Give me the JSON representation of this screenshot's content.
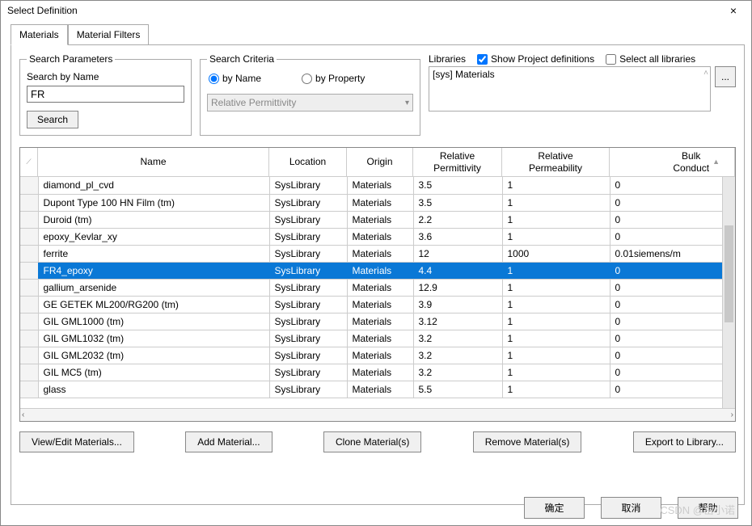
{
  "window": {
    "title": "Select Definition",
    "close": "×"
  },
  "tabs": {
    "materials": "Materials",
    "filters": "Material Filters"
  },
  "search_params": {
    "legend": "Search Parameters",
    "label": "Search by Name",
    "value": "FR",
    "button": "Search"
  },
  "search_criteria": {
    "legend": "Search Criteria",
    "by_name": "by Name",
    "by_property": "by Property",
    "selected": "name",
    "property_dropdown": "Relative Permittivity"
  },
  "libraries": {
    "label": "Libraries",
    "show_project": "Show Project definitions",
    "show_project_checked": true,
    "select_all": "Select all libraries",
    "select_all_checked": false,
    "item": "[sys] Materials",
    "browse": "..."
  },
  "grid": {
    "columns": [
      "",
      "Name",
      "Location",
      "Origin",
      "Relative\nPermittivity",
      "Relative\nPermeability",
      "Bulk\nConduct"
    ],
    "col_arrow": "▲",
    "rows": [
      {
        "name": "diamond_pl_cvd",
        "location": "SysLibrary",
        "origin": "Materials",
        "perm": "3.5",
        "permeab": "1",
        "bulk": "0",
        "selected": false
      },
      {
        "name": "Dupont Type 100 HN Film (tm)",
        "location": "SysLibrary",
        "origin": "Materials",
        "perm": "3.5",
        "permeab": "1",
        "bulk": "0",
        "selected": false
      },
      {
        "name": "Duroid (tm)",
        "location": "SysLibrary",
        "origin": "Materials",
        "perm": "2.2",
        "permeab": "1",
        "bulk": "0",
        "selected": false
      },
      {
        "name": "epoxy_Kevlar_xy",
        "location": "SysLibrary",
        "origin": "Materials",
        "perm": "3.6",
        "permeab": "1",
        "bulk": "0",
        "selected": false
      },
      {
        "name": "ferrite",
        "location": "SysLibrary",
        "origin": "Materials",
        "perm": "12",
        "permeab": "1000",
        "bulk": "0.01siemens/m",
        "selected": false
      },
      {
        "name": "FR4_epoxy",
        "location": "SysLibrary",
        "origin": "Materials",
        "perm": "4.4",
        "permeab": "1",
        "bulk": "0",
        "selected": true
      },
      {
        "name": "gallium_arsenide",
        "location": "SysLibrary",
        "origin": "Materials",
        "perm": "12.9",
        "permeab": "1",
        "bulk": "0",
        "selected": false
      },
      {
        "name": "GE GETEK ML200/RG200 (tm)",
        "location": "SysLibrary",
        "origin": "Materials",
        "perm": "3.9",
        "permeab": "1",
        "bulk": "0",
        "selected": false
      },
      {
        "name": "GIL GML1000 (tm)",
        "location": "SysLibrary",
        "origin": "Materials",
        "perm": "3.12",
        "permeab": "1",
        "bulk": "0",
        "selected": false
      },
      {
        "name": "GIL GML1032 (tm)",
        "location": "SysLibrary",
        "origin": "Materials",
        "perm": "3.2",
        "permeab": "1",
        "bulk": "0",
        "selected": false
      },
      {
        "name": "GIL GML2032 (tm)",
        "location": "SysLibrary",
        "origin": "Materials",
        "perm": "3.2",
        "permeab": "1",
        "bulk": "0",
        "selected": false
      },
      {
        "name": "GIL MC5 (tm)",
        "location": "SysLibrary",
        "origin": "Materials",
        "perm": "3.2",
        "permeab": "1",
        "bulk": "0",
        "selected": false
      },
      {
        "name": "glass",
        "location": "SysLibrary",
        "origin": "Materials",
        "perm": "5.5",
        "permeab": "1",
        "bulk": "0",
        "selected": false
      }
    ]
  },
  "buttons": {
    "view_edit": "View/Edit Materials...",
    "add": "Add Material...",
    "clone": "Clone Material(s)",
    "remove": "Remove Material(s)",
    "export": "Export to Library..."
  },
  "footer": {
    "ok": "确定",
    "cancel": "取消",
    "help": "帮助"
  },
  "watermark": "CSDN @岳小诺"
}
